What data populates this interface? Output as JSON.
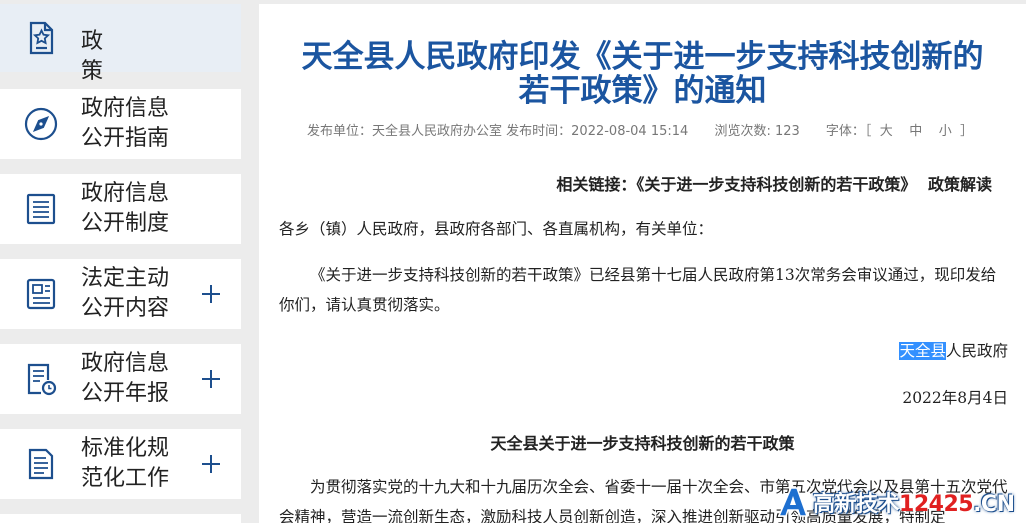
{
  "sidebar": {
    "items": [
      {
        "label": "政策",
        "icon": "star-document-icon",
        "plus": false,
        "active": true
      },
      {
        "label": "政府信息\n公开指南",
        "icon": "compass-icon",
        "plus": false,
        "active": false
      },
      {
        "label": "政府信息\n公开制度",
        "icon": "list-document-icon",
        "plus": false,
        "active": false
      },
      {
        "label": "法定主动\n公开内容",
        "icon": "newspaper-icon",
        "plus": true,
        "active": false
      },
      {
        "label": "政府信息\n公开年报",
        "icon": "report-clock-icon",
        "plus": true,
        "active": false
      },
      {
        "label": "标准化规\n范化工作",
        "icon": "text-document-icon",
        "plus": true,
        "active": false
      }
    ]
  },
  "article": {
    "title_line1": "天全县人民政府印发《关于进一步支持科技创新的",
    "title_line2": "若干政策》的通知",
    "meta": {
      "publisher": "发布单位：天全县人民政府办公室",
      "publish_time": "发布时间：2022-08-04 15:14",
      "views": "浏览次数: 123",
      "font_label": "字体：［",
      "font_large": "大",
      "font_medium": "中",
      "font_small": "小",
      "font_close": "］"
    },
    "related_prefix": "相关链接：",
    "related_link": "《关于进一步支持科技创新的若干政策》",
    "related_interpret": "政策解读",
    "salutation": "各乡（镇）人民政府，县政府各部门、各直属机构，有关单位：",
    "body": "《关于进一步支持科技创新的若干政策》已经县第十七届人民政府第13次常务会审议通过，现印发给你们，请认真贯彻落实。",
    "signer_highlight": "天全县",
    "signer_rest": "人民政府",
    "date": "2022年8月4日",
    "subtitle": "天全县关于进一步支持科技创新的若干政策",
    "body2": "为贯彻落实党的十九大和十九届历次全会、省委十一届十次全会、市第五次党代会以及县第十五次党代会精神，营造一流创新生态，激励科技人员创新创造，深入推进创新驱动引领高质量发展，特制定"
  },
  "watermark": {
    "text_main": "高新技术",
    "text_num": "12425",
    "text_suffix": ".CN"
  }
}
